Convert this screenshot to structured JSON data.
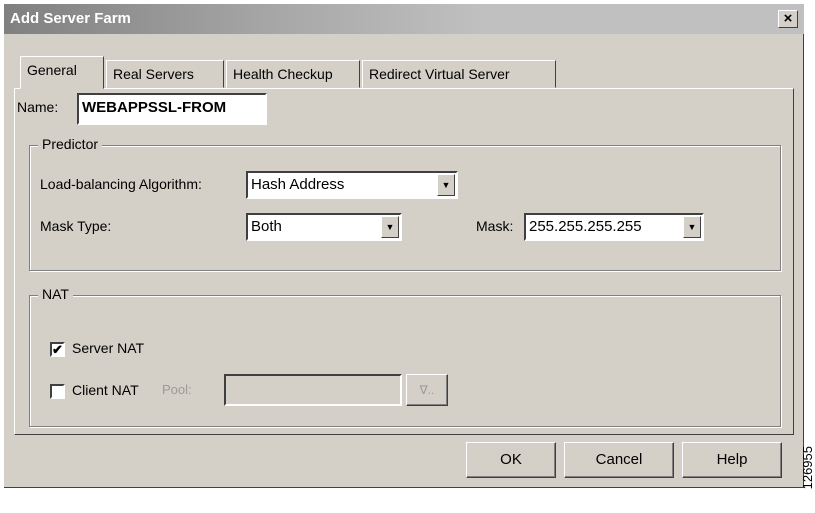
{
  "window": {
    "title": "Add Server Farm",
    "close_label": "×"
  },
  "tabs": [
    {
      "label": "General",
      "active": true
    },
    {
      "label": "Real Servers",
      "active": false
    },
    {
      "label": "Health Checkup",
      "active": false
    },
    {
      "label": "Redirect Virtual Server",
      "active": false
    }
  ],
  "general": {
    "name_label": "Name:",
    "name_value": "WEBAPPSSL-FROM",
    "predictor": {
      "legend": "Predictor",
      "algorithm_label": "Load-balancing Algorithm:",
      "algorithm_value": "Hash Address",
      "mask_type_label": "Mask Type:",
      "mask_type_value": "Both",
      "mask_label": "Mask:",
      "mask_value": "255.255.255.255"
    },
    "nat": {
      "legend": "NAT",
      "server_nat_label": "Server NAT",
      "server_nat_checked": true,
      "client_nat_label": "Client NAT",
      "client_nat_checked": false,
      "pool_label": "Pool:",
      "pool_value": "",
      "pool_button_label": "∇.."
    }
  },
  "buttons": {
    "ok": "OK",
    "cancel": "Cancel",
    "help": "Help"
  },
  "watermark": "126955",
  "check_glyph": "✔"
}
